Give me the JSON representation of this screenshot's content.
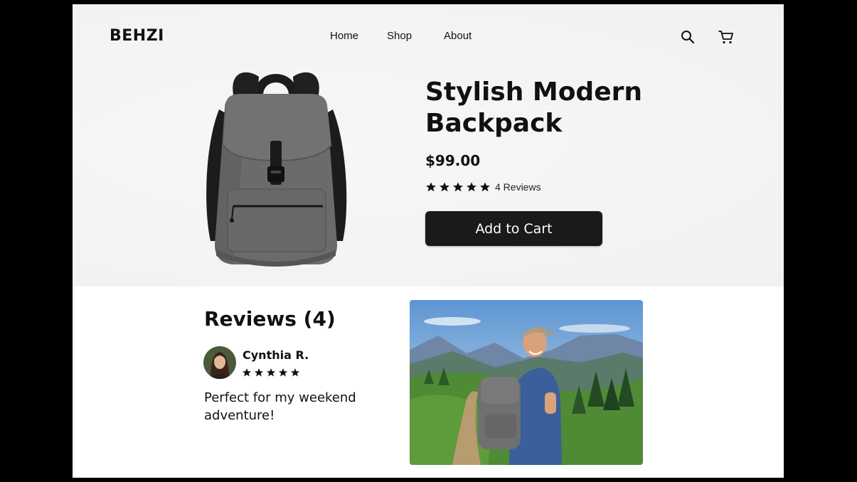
{
  "header": {
    "logo": "BEHZI",
    "nav": [
      {
        "label": "Home"
      },
      {
        "label": "Shop"
      },
      {
        "label": "About"
      }
    ],
    "icons": [
      "search-icon",
      "cart-icon"
    ]
  },
  "product": {
    "title": "Stylish Modern Backpack",
    "price": "$99.00",
    "rating": 5,
    "review_count_label": "4 Reviews",
    "add_to_cart_label": "Add to Cart",
    "image": "grey-backpack-product-photo"
  },
  "reviews": {
    "heading": "Reviews (4)",
    "items": [
      {
        "name": "Cynthia R.",
        "rating": 5,
        "text": "Perfect for my weekend adventure!",
        "avatar": "reviewer-avatar"
      }
    ],
    "lifestyle_image": "hiker-with-backpack-photo"
  },
  "colors": {
    "accent": "#1a1a1a",
    "hero_bg": "#f4f4f4",
    "page_bg": "#ffffff",
    "outer_bg": "#000000"
  }
}
